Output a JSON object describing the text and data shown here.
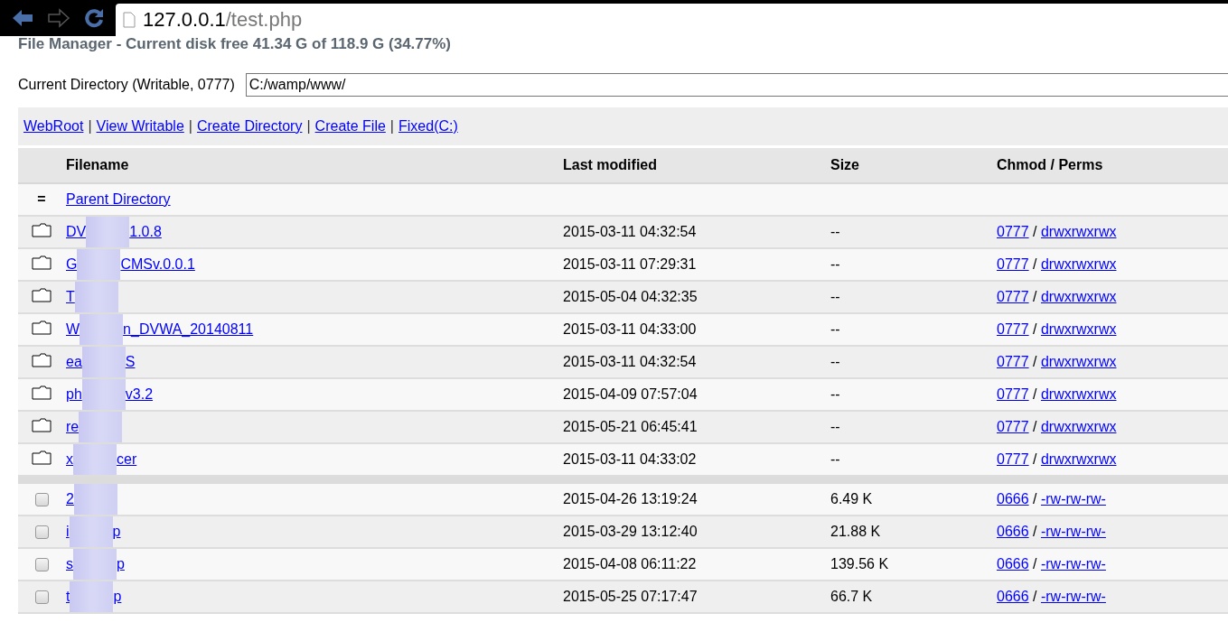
{
  "browser": {
    "host": "127.0.0.1",
    "path": "/test.php"
  },
  "title": "File Manager - Current disk free 41.34 G of 118.9 G (34.77%)",
  "current_directory": {
    "label": "Current Directory (Writable, 0777)",
    "value": "C:/wamp/www/"
  },
  "links": [
    "WebRoot",
    "View Writable",
    "Create Directory",
    "Create File",
    "Fixed(C:)"
  ],
  "link_separator": "|",
  "perms_separator": "/",
  "table": {
    "columns": [
      "Filename",
      "Last modified",
      "Size",
      "Chmod / Perms"
    ],
    "parent": {
      "marker": "=",
      "name": "Parent Directory"
    },
    "rows": [
      {
        "kind": "folder",
        "name_head": "DV",
        "name_tail": "1.0.8",
        "modified": "2015-03-11 04:32:54",
        "size": "--",
        "mode": "0777",
        "perms": "drwxrwxrwx"
      },
      {
        "kind": "folder",
        "name_head": "G",
        "name_tail": "CMSv.0.0.1",
        "modified": "2015-03-11 07:29:31",
        "size": "--",
        "mode": "0777",
        "perms": "drwxrwxrwx"
      },
      {
        "kind": "folder",
        "name_head": "T",
        "name_tail": "",
        "modified": "2015-05-04 04:32:35",
        "size": "--",
        "mode": "0777",
        "perms": "drwxrwxrwx"
      },
      {
        "kind": "folder",
        "name_head": "W",
        "name_tail": "n_DVWA_20140811",
        "modified": "2015-03-11 04:33:00",
        "size": "--",
        "mode": "0777",
        "perms": "drwxrwxrwx"
      },
      {
        "kind": "folder",
        "name_head": "ea",
        "name_tail": "S",
        "modified": "2015-03-11 04:32:54",
        "size": "--",
        "mode": "0777",
        "perms": "drwxrwxrwx"
      },
      {
        "kind": "folder",
        "name_head": "ph",
        "name_tail": "v3.2",
        "modified": "2015-04-09 07:57:04",
        "size": "--",
        "mode": "0777",
        "perms": "drwxrwxrwx"
      },
      {
        "kind": "folder",
        "name_head": "re",
        "name_tail": "",
        "modified": "2015-05-21 06:45:41",
        "size": "--",
        "mode": "0777",
        "perms": "drwxrwxrwx"
      },
      {
        "kind": "folder",
        "name_head": "x",
        "name_tail": "cer",
        "modified": "2015-03-11 04:33:02",
        "size": "--",
        "mode": "0777",
        "perms": "drwxrwxrwx"
      },
      {
        "kind": "separator"
      },
      {
        "kind": "file",
        "checked": false,
        "name_head": "2",
        "name_tail": "",
        "modified": "2015-04-26 13:19:24",
        "size": "6.49 K",
        "mode": "0666",
        "perms": "-rw-rw-rw-"
      },
      {
        "kind": "file",
        "checked": false,
        "name_head": "i",
        "name_tail": "p",
        "modified": "2015-03-29 13:12:40",
        "size": "21.88 K",
        "mode": "0666",
        "perms": "-rw-rw-rw-"
      },
      {
        "kind": "file",
        "checked": false,
        "name_head": "s",
        "name_tail": "p",
        "modified": "2015-04-08 06:11:22",
        "size": "139.56 K",
        "mode": "0666",
        "perms": "-rw-rw-rw-"
      },
      {
        "kind": "file",
        "checked": false,
        "name_head": "t",
        "name_tail": "p",
        "modified": "2015-05-25 07:17:47",
        "size": "66.7 K",
        "mode": "0666",
        "perms": "-rw-rw-rw-"
      }
    ]
  }
}
